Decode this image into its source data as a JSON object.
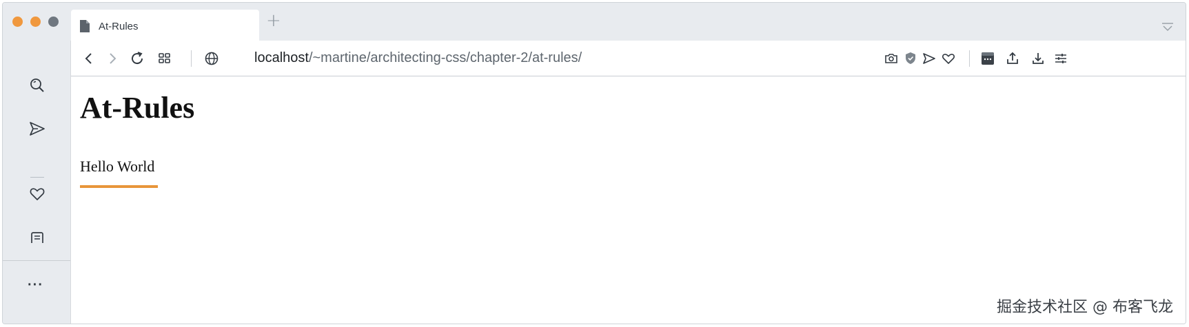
{
  "tab": {
    "title": "At-Rules",
    "new_tab_glyph": "+"
  },
  "address_bar": {
    "host": "localhost",
    "path": "/~martine/architecting-css/chapter-2/at-rules/"
  },
  "toolbar_icons": [
    "back-icon",
    "forward-icon",
    "reload-icon",
    "tab-grid-icon",
    "globe-icon",
    "camera-icon",
    "shield-icon",
    "send-icon",
    "heart-icon",
    "extension-icon",
    "share-icon",
    "download-icon",
    "settings-sliders-icon"
  ],
  "sidebar": {
    "icons": [
      "search-icon",
      "send-icon",
      "heart-icon",
      "notes-icon"
    ],
    "more_label": "···"
  },
  "page": {
    "heading": "At-Rules",
    "paragraph": "Hello World",
    "accent_color": "#e8953a"
  },
  "watermark": "掘金技术社区 @ 布客飞龙"
}
